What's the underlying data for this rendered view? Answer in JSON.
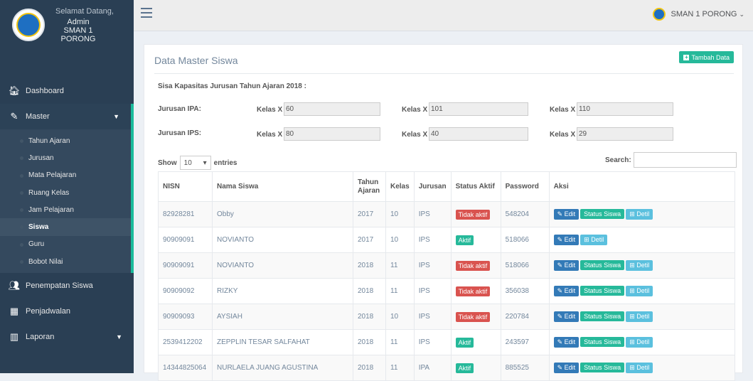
{
  "sidebar": {
    "welcome": "Selamat Datang,",
    "user_line1": "Admin SMAN 1",
    "user_line2": "PORONG",
    "menu": {
      "dashboard": "Dashboard",
      "master": "Master",
      "penempatan": "Penempatan Siswa",
      "penjadwalan": "Penjadwalan",
      "laporan": "Laporan"
    },
    "submenu": [
      "Tahun Ajaran",
      "Jurusan",
      "Mata Pelajaran",
      "Ruang Kelas",
      "Jam Pelajaran",
      "Siswa",
      "Guru",
      "Bobot Nilai"
    ]
  },
  "topbar": {
    "user": "SMAN 1 PORONG"
  },
  "panel": {
    "title": "Data Master Siswa",
    "add_button": "Tambah Data",
    "capacity_title": "Sisa Kapasitas Jurusan Tahun Ajaran 2018 :",
    "ipa_label": "Jurusan IPA:",
    "ips_label": "Jurusan IPS:",
    "kelas_label": "Kelas X",
    "ipa": [
      "60",
      "101",
      "110"
    ],
    "ips": [
      "80",
      "40",
      "29"
    ],
    "show": "Show",
    "entries_value": "10",
    "entries": "entries",
    "search": "Search:"
  },
  "table": {
    "headers": [
      "NISN",
      "Nama Siswa",
      "Tahun Ajaran",
      "Kelas",
      "Jurusan",
      "Status Aktif",
      "Password",
      "Aksi"
    ],
    "rows": [
      {
        "nisn": "82928281",
        "nama": "Obby",
        "tahun": "2017",
        "kelas": "10",
        "jurusan": "IPS",
        "status": "Tidak aktif",
        "password": "548204",
        "status_btn": true
      },
      {
        "nisn": "90909091",
        "nama": "NOVIANTO",
        "tahun": "2017",
        "kelas": "10",
        "jurusan": "IPS",
        "status": "Aktif",
        "password": "518066",
        "status_btn": false
      },
      {
        "nisn": "90909091",
        "nama": "NOVIANTO",
        "tahun": "2018",
        "kelas": "11",
        "jurusan": "IPS",
        "status": "Tidak aktif",
        "password": "518066",
        "status_btn": true
      },
      {
        "nisn": "90909092",
        "nama": "RIZKY",
        "tahun": "2018",
        "kelas": "11",
        "jurusan": "IPS",
        "status": "Tidak aktif",
        "password": "356038",
        "status_btn": true
      },
      {
        "nisn": "90909093",
        "nama": "AYSIAH",
        "tahun": "2018",
        "kelas": "10",
        "jurusan": "IPS",
        "status": "Tidak aktif",
        "password": "220784",
        "status_btn": true
      },
      {
        "nisn": "2539412202",
        "nama": "ZEPPLIN TESAR SALFAHAT",
        "tahun": "2018",
        "kelas": "11",
        "jurusan": "IPS",
        "status": "Aktif",
        "password": "243597",
        "status_btn": true
      },
      {
        "nisn": "14344825064",
        "nama": "NURLAELA JUANG AGUSTINA",
        "tahun": "2018",
        "kelas": "11",
        "jurusan": "IPA",
        "status": "Aktif",
        "password": "885525",
        "status_btn": true
      }
    ],
    "edit_label": "Edit",
    "status_label": "Status Siswa",
    "detil_label": "Detil"
  }
}
